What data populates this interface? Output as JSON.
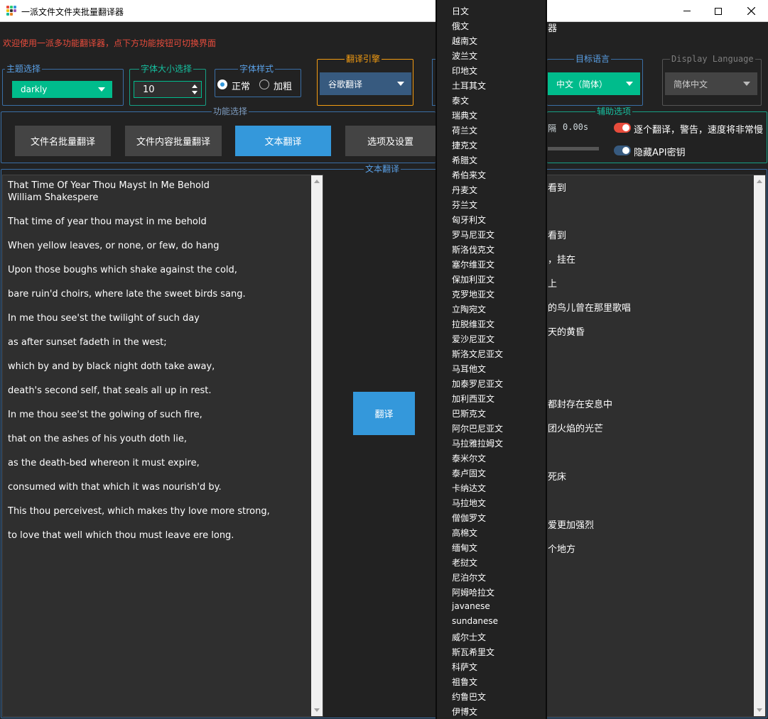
{
  "window": {
    "title": "一派文件文件夹批量翻译器"
  },
  "welcome": "欢迎使用一派多功能翻译器，点下方功能按钮可切换界面",
  "theme": {
    "legend": "主题选择",
    "value": "darkly"
  },
  "fontsize": {
    "legend": "字体大小选择",
    "value": "10"
  },
  "fontstyle": {
    "legend": "字体样式",
    "normal": "正常",
    "bold": "加粗"
  },
  "engine": {
    "legend": "翻译引擎",
    "value": "谷歌翻译"
  },
  "target": {
    "legend": "目标语言",
    "value": "中文（简体）"
  },
  "display": {
    "legend": "Display Language",
    "value": "简体中文"
  },
  "func": {
    "legend": "功能选择",
    "buttons": [
      "文件名批量翻译",
      "文件内容批量翻译",
      "文本翻译",
      "选项及设置"
    ]
  },
  "aux": {
    "legend": "辅助选项",
    "partial_label": "隔",
    "time": "0.00s",
    "opt1": "逐个翻译，警告，速度将非常慢",
    "opt2": "隐藏API密钥"
  },
  "text_section": {
    "legend": "文本翻译",
    "translate_btn": "翻译"
  },
  "source_lines": [
    "That Time Of Year Thou Mayst In Me Behold",
    "William Shakespere",
    "That time of year thou mayst in me behold",
    "When yellow leaves, or none, or few, do hang",
    "Upon those boughs which shake against the cold,",
    "bare ruin'd choirs, where late the sweet birds sang.",
    "In me thou see'st the twilight of such day",
    "as after sunset fadeth in the west;",
    "which by and by black night doth take away,",
    "death's second self, that seals all up in rest.",
    "In me thou see'st the golwing of such fire,",
    "that on the ashes of his youth doth lie,",
    "as the death-bed whereon it must expire,",
    "consumed with that which it was nourish'd by.",
    "This thou perceivest, which makes thy love more strong,",
    "to love that well which thou must leave ere long."
  ],
  "result_lines": [
    "看到",
    "看到",
    "，挂在",
    "上",
    "的鸟儿曾在那里歌唱",
    "天的黄昏",
    "都封存在安息中",
    "团火焰的光芒",
    "死床",
    "爱更加强烈",
    "个地方"
  ],
  "partial_header": "器",
  "languages": [
    "日文",
    "俄文",
    "越南文",
    "波兰文",
    "印地文",
    "土耳其文",
    "泰文",
    "瑞典文",
    "荷兰文",
    "捷克文",
    "希腊文",
    "希伯来文",
    "丹麦文",
    "芬兰文",
    "匈牙利文",
    "罗马尼亚文",
    "斯洛伐克文",
    "塞尔维亚文",
    "保加利亚文",
    "克罗地亚文",
    "立陶宛文",
    "拉脱维亚文",
    "爱沙尼亚文",
    "斯洛文尼亚文",
    "马耳他文",
    "加泰罗尼亚文",
    "加利西亚文",
    "巴斯克文",
    "阿尔巴尼亚文",
    "马拉雅拉姆文",
    "泰米尔文",
    "泰卢固文",
    "卡纳达文",
    "马拉地文",
    "僧伽罗文",
    "高棉文",
    "缅甸文",
    "老挝文",
    "尼泊尔文",
    "阿姆哈拉文",
    "javanese",
    "sundanese",
    "威尔士文",
    "斯瓦希里文",
    "科萨文",
    "祖鲁文",
    "约鲁巴文",
    "伊博文"
  ],
  "colors": {
    "accent_blue": "#3498db",
    "teal": "#00bc8c",
    "danger": "#e74c3c",
    "engine_bg": "#375a7f"
  }
}
